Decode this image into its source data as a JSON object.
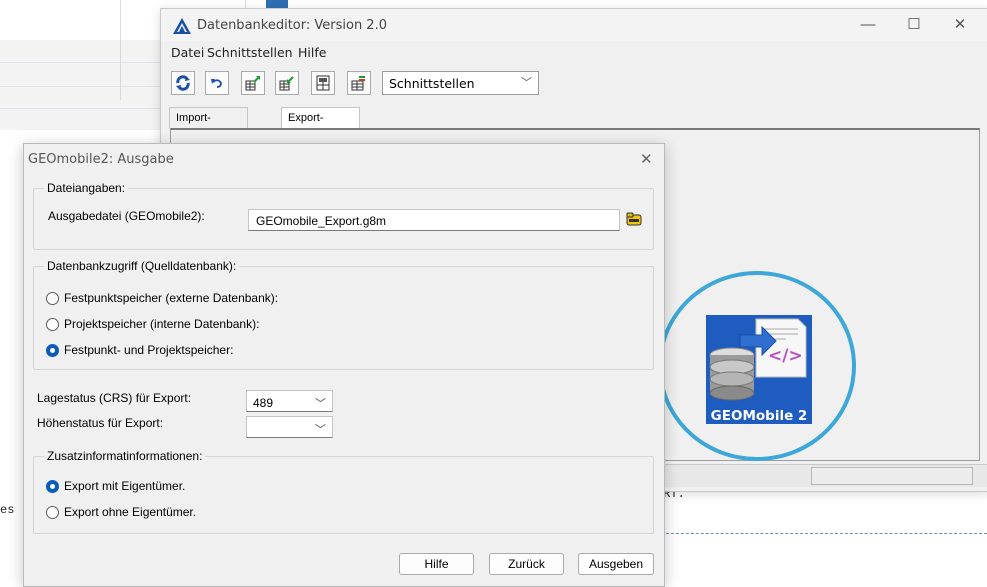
{
  "editor": {
    "title": "Datenbankeditor: Version 2.0",
    "menu": [
      "Datei",
      "Schnittstellen",
      "Hilfe"
    ],
    "toolbar_combo": "Schnittstellen",
    "tabs": [
      "Import-Schnittstellen",
      "Export-Schnittstellen"
    ],
    "active_tab": "Export-Schnittstellen"
  },
  "background": {
    "terminal_text": "ERT.",
    "terminal_text_left": "es"
  },
  "logo": {
    "text": "GEOMobile 2",
    "ring_color": "#3ca7d8",
    "bg_color": "#1e5cbf"
  },
  "dialog": {
    "title": "GEOmobile2: Ausgabe",
    "file_group": {
      "label": "Dateiangaben:",
      "output_label": "Ausgabedatei (GEOmobile2):",
      "output_value": "GEOmobile_Export.g8m"
    },
    "db_group": {
      "label": "Datenbankzugriff (Quelldatenbank):",
      "options": [
        {
          "label": "Festpunktspeicher (externe Datenbank):",
          "checked": false
        },
        {
          "label": "Projektspeicher (interne Datenbank):",
          "checked": false
        },
        {
          "label": "Festpunkt- und Projektspeicher:",
          "checked": true
        }
      ]
    },
    "lage_label": "Lagestatus (CRS) für Export:",
    "lage_value": "489",
    "hoehe_label": "Höhenstatus für Export:",
    "hoehe_value": "",
    "extra_group": {
      "label": "Zusatzinformatinformationen:",
      "options": [
        {
          "label": "Export mit Eigentümer.",
          "checked": true
        },
        {
          "label": "Export ohne Eigentümer.",
          "checked": false
        }
      ]
    },
    "buttons": {
      "help": "Hilfe",
      "back": "Zurück",
      "export": "Ausgeben"
    }
  }
}
